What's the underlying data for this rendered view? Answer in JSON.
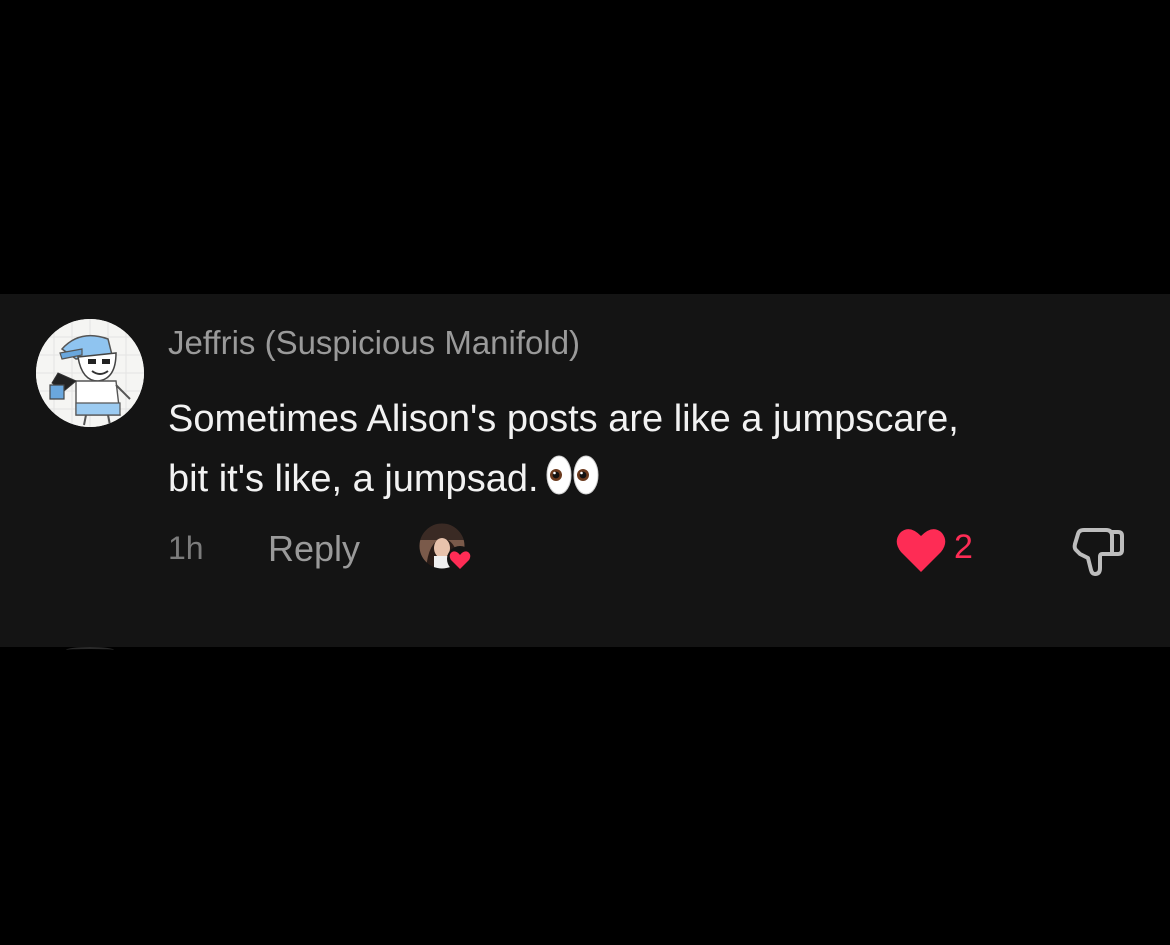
{
  "comment": {
    "author": "Jeffris (Suspicious Manifold)",
    "text": "Sometimes Alison's posts are like a jumpscare, bit it's like, a jumpsad.",
    "emoji": "eyes-emoji",
    "timestamp": "1h",
    "reply_label": "Reply",
    "like_count": "2",
    "liked": true,
    "icons": {
      "like": "heart-icon",
      "dislike": "thumbs-down-icon",
      "liked_by": "creator-avatar-with-heart-icon"
    }
  },
  "colors": {
    "background": "#000000",
    "card": "#141414",
    "like_accent": "#fe2c55",
    "author": "#9a9a9a",
    "text": "#f2f2f2"
  }
}
